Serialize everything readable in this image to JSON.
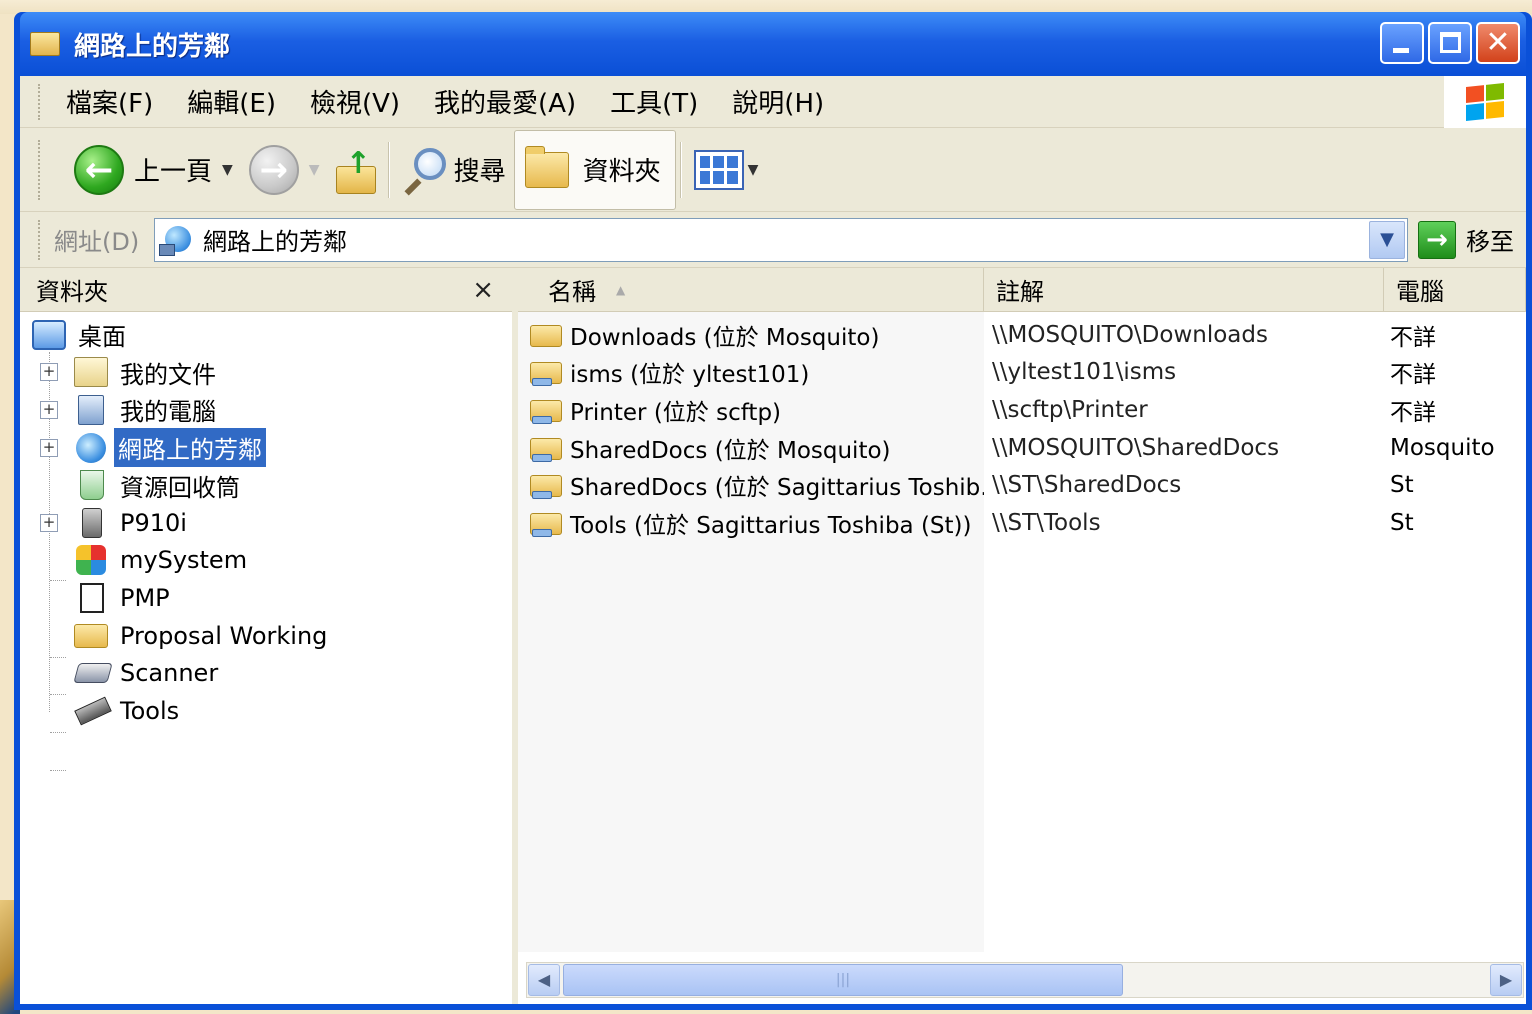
{
  "window": {
    "title": "網路上的芳鄰"
  },
  "menu": {
    "items": [
      "檔案(F)",
      "編輯(E)",
      "檢視(V)",
      "我的最愛(A)",
      "工具(T)",
      "說明(H)"
    ]
  },
  "toolbar": {
    "back_label": "上一頁",
    "search_label": "搜尋",
    "folders_label": "資料夾"
  },
  "address": {
    "label": "網址(D)",
    "value": "網路上的芳鄰",
    "go_label": "移至"
  },
  "folders_pane": {
    "title": "資料夾",
    "close_glyph": "×",
    "tree": [
      {
        "label": "桌面"
      },
      {
        "label": "我的文件"
      },
      {
        "label": "我的電腦"
      },
      {
        "label": "網路上的芳鄰"
      },
      {
        "label": "資源回收筒"
      },
      {
        "label": "P910i"
      },
      {
        "label": "mySystem"
      },
      {
        "label": "PMP"
      },
      {
        "label": "Proposal Working"
      },
      {
        "label": "Scanner"
      },
      {
        "label": "Tools"
      }
    ]
  },
  "list": {
    "columns": {
      "name": "名稱",
      "comment": "註解",
      "computer": "電腦"
    },
    "rows": [
      {
        "name": "Downloads (位於 Mosquito)",
        "comment": "\\\\MOSQUITO\\Downloads",
        "computer": "不詳"
      },
      {
        "name": "isms (位於 yltest101)",
        "comment": "\\\\yltest101\\isms",
        "computer": "不詳"
      },
      {
        "name": "Printer (位於 scftp)",
        "comment": "\\\\scftp\\Printer",
        "computer": "不詳"
      },
      {
        "name": "SharedDocs (位於 Mosquito)",
        "comment": "\\\\MOSQUITO\\SharedDocs",
        "computer": "Mosquito"
      },
      {
        "name": "SharedDocs (位於 Sagittarius Toshib...",
        "comment": "\\\\ST\\SharedDocs",
        "computer": "St"
      },
      {
        "name": "Tools (位於 Sagittarius Toshiba (St))",
        "comment": "\\\\ST\\Tools",
        "computer": "St"
      }
    ]
  },
  "colors": {
    "titlebar": "#0a50d8",
    "selection": "#316ac5",
    "chrome": "#ece9d8"
  }
}
